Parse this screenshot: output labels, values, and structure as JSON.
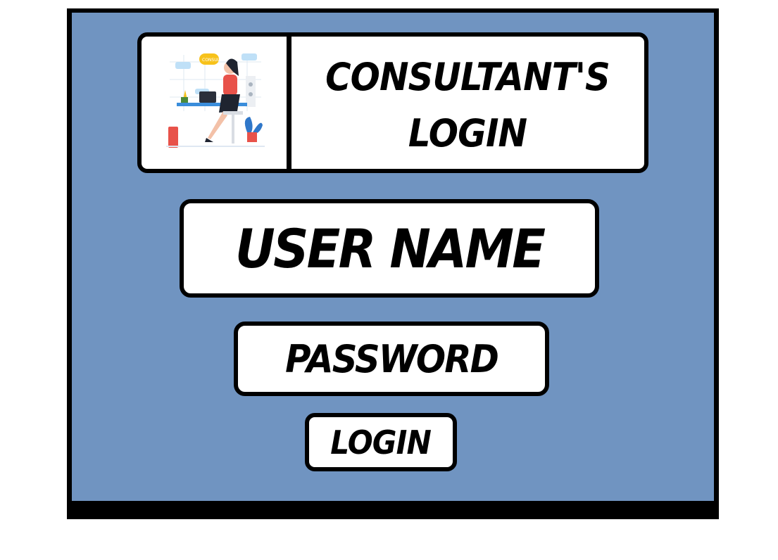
{
  "header": {
    "title_line1": "CONSULTANT'S",
    "title_line2": "LOGIN",
    "illustration_sign": "CONSULTANT"
  },
  "form": {
    "username_label": "USER NAME",
    "password_label": "PASSWORD",
    "login_label": "LOGIN"
  },
  "colors": {
    "background_panel": "#7094c1",
    "box_fill": "#ffffff",
    "border": "#000000",
    "illustration_accent": "#e8524a",
    "illustration_blue": "#3a8ddb",
    "illustration_yellow": "#f7c21b"
  },
  "icons": {
    "illustration": "consultant-at-desk-illustration"
  }
}
